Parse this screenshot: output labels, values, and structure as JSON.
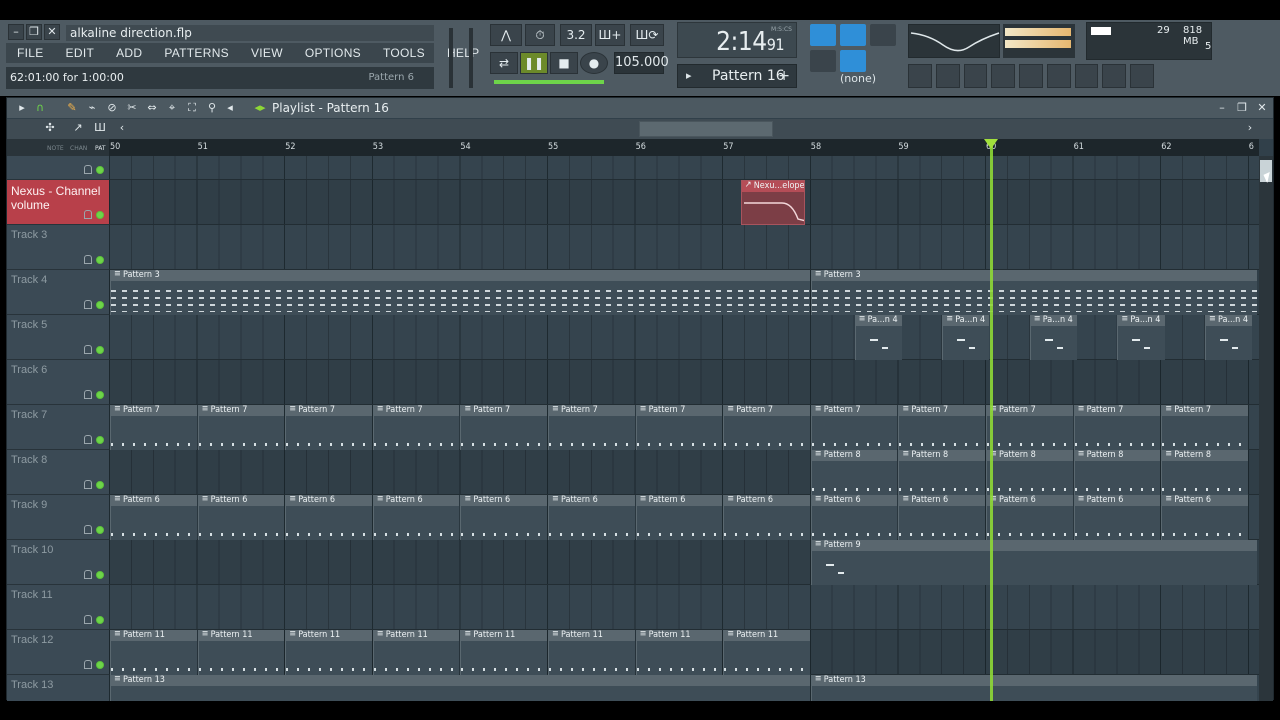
{
  "header": {
    "file_title": "alkaline direction.flp",
    "menu": [
      "FILE",
      "EDIT",
      "ADD",
      "PATTERNS",
      "VIEW",
      "OPTIONS",
      "TOOLS",
      "HELP"
    ],
    "hint": "62:01:00 for 1:00:00",
    "hint_pattern": "Pattern 6",
    "tempo": "105.000",
    "time": "2:14",
    "time_sub": "91",
    "time_unit": "M:S:CS",
    "snap_value": "3.2",
    "current_pattern": "Pattern 16",
    "snap_none": "(none)",
    "cpu": "29",
    "memory": "818 MB",
    "polyphony": "5"
  },
  "playlist": {
    "title": "Playlist - Pattern 16",
    "header_labels": [
      "NOTE",
      "CHAN",
      "PAT"
    ],
    "bars": [
      "50",
      "51",
      "52",
      "53",
      "54",
      "55",
      "56",
      "57",
      "58",
      "59",
      "60",
      "61",
      "62",
      "6"
    ],
    "tracks": [
      {
        "name": "",
        "active": false
      },
      {
        "name": "Nexus - Channel volume",
        "active": true
      },
      {
        "name": "Track 3",
        "active": false
      },
      {
        "name": "Track 4",
        "active": false
      },
      {
        "name": "Track 5",
        "active": false
      },
      {
        "name": "Track 6",
        "active": false
      },
      {
        "name": "Track 7",
        "active": false
      },
      {
        "name": "Track 8",
        "active": false
      },
      {
        "name": "Track 9",
        "active": false
      },
      {
        "name": "Track 10",
        "active": false
      },
      {
        "name": "Track 11",
        "active": false
      },
      {
        "name": "Track 12",
        "active": false
      },
      {
        "name": "Track 13",
        "active": false
      }
    ],
    "clip_labels": {
      "automation": "Nexu...elope",
      "p3": "Pattern 3",
      "p4": "Pa...n 4",
      "p7": "Pattern 7",
      "p8": "Pattern 8",
      "p6": "Pattern 6",
      "p9": "Pattern 9",
      "p11": "Pattern 11",
      "p13": "Pattern 13"
    }
  },
  "colors": {
    "accent_green": "#8ed836",
    "active_track": "#b8404a",
    "blue_buttons": "#2f8fd8"
  }
}
